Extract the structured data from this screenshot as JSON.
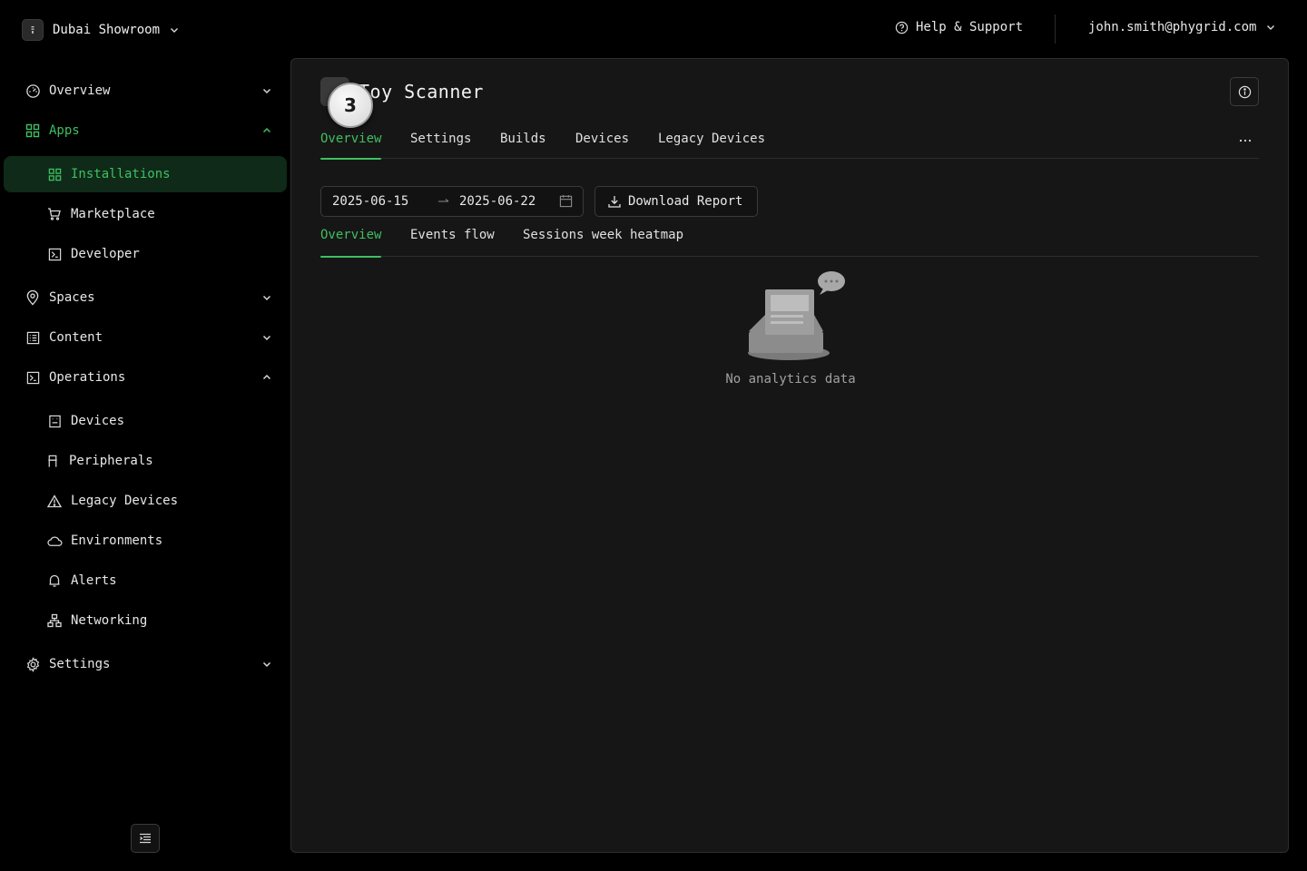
{
  "header": {
    "org_name": "Dubai Showroom",
    "help_label": "Help & Support",
    "user_email": "john.smith@phygrid.com"
  },
  "sidebar": {
    "items": [
      {
        "label": "Overview",
        "icon": "gauge-icon"
      },
      {
        "label": "Apps",
        "icon": "grid-icon"
      },
      {
        "label": "Installations",
        "icon": "grid-icon"
      },
      {
        "label": "Marketplace",
        "icon": "cart-icon"
      },
      {
        "label": "Developer",
        "icon": "terminal-icon"
      },
      {
        "label": "Spaces",
        "icon": "location-pin-icon"
      },
      {
        "label": "Content",
        "icon": "list-icon"
      },
      {
        "label": "Operations",
        "icon": "terminal-icon"
      },
      {
        "label": "Devices",
        "icon": "device-icon"
      },
      {
        "label": "Peripherals",
        "icon": "peripheral-icon"
      },
      {
        "label": "Legacy Devices",
        "icon": "warning-icon"
      },
      {
        "label": "Environments",
        "icon": "cloud-icon"
      },
      {
        "label": "Alerts",
        "icon": "bell-icon"
      },
      {
        "label": "Networking",
        "icon": "network-icon"
      },
      {
        "label": "Settings",
        "icon": "gear-icon"
      }
    ]
  },
  "app": {
    "title": "Toy Scanner",
    "badge": "3"
  },
  "tabs": [
    "Overview",
    "Settings",
    "Builds",
    "Devices",
    "Legacy Devices"
  ],
  "filters": {
    "start_date": "2025-06-15",
    "end_date": "2025-06-22",
    "download_label": "Download Report"
  },
  "subtabs": [
    "Overview",
    "Events flow",
    "Sessions week heatmap"
  ],
  "empty_state": {
    "message": "No analytics data"
  },
  "colors": {
    "accent": "#3fbf62",
    "active_bg": "#0f2a18",
    "panel_bg": "#161616",
    "page_bg": "#000000"
  }
}
